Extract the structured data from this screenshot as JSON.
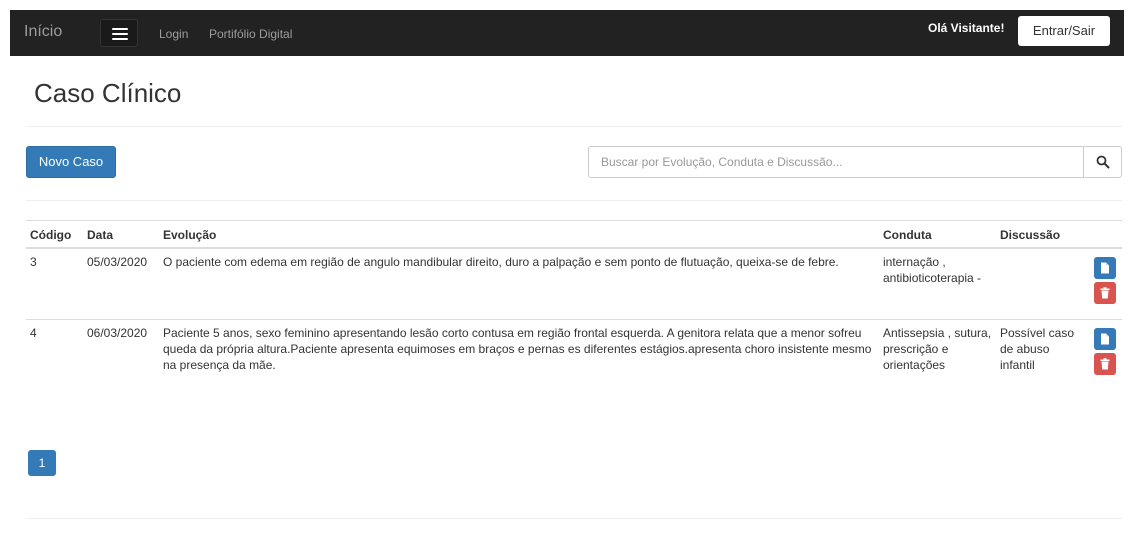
{
  "nav": {
    "brand": "Início",
    "links": [
      "Login",
      "Portifólio Digital"
    ],
    "greeting": "Olá Visitante!",
    "login_button": "Entrar/Sair"
  },
  "page": {
    "title": "Caso Clínico",
    "new_button": "Novo Caso",
    "search_placeholder": "Buscar por Evolução, Conduta e Discussão..."
  },
  "table": {
    "headers": [
      "Código",
      "Data",
      "Evolução",
      "Conduta",
      "Discussão"
    ],
    "rows": [
      {
        "codigo": "3",
        "data": "05/03/2020",
        "evolucao": "O paciente com edema em região de angulo mandibular direito, duro a palpação e sem ponto de flutuação, queixa-se de febre.",
        "conduta": "internação , antibioticoterapia -",
        "discussao": ""
      },
      {
        "codigo": "4",
        "data": "06/03/2020",
        "evolucao": "Paciente 5 anos, sexo feminino apresentando lesão corto contusa em região frontal esquerda. A genitora relata que a menor sofreu queda da própria altura.Paciente apresenta equimoses em braços e pernas es diferentes estágios.apresenta choro insistente mesmo na presença da mãe.",
        "conduta": "Antissepsia , sutura, prescrição e orientações",
        "discussao": "Possível caso de abuso infantil"
      }
    ]
  },
  "pagination": {
    "current": "1"
  },
  "icons": {
    "menu": "hamburger-icon",
    "search": "search-icon",
    "edit": "file-icon",
    "delete": "trash-icon"
  },
  "colors": {
    "navbar": "#222222",
    "primary": "#337ab7",
    "danger": "#d9534f"
  }
}
